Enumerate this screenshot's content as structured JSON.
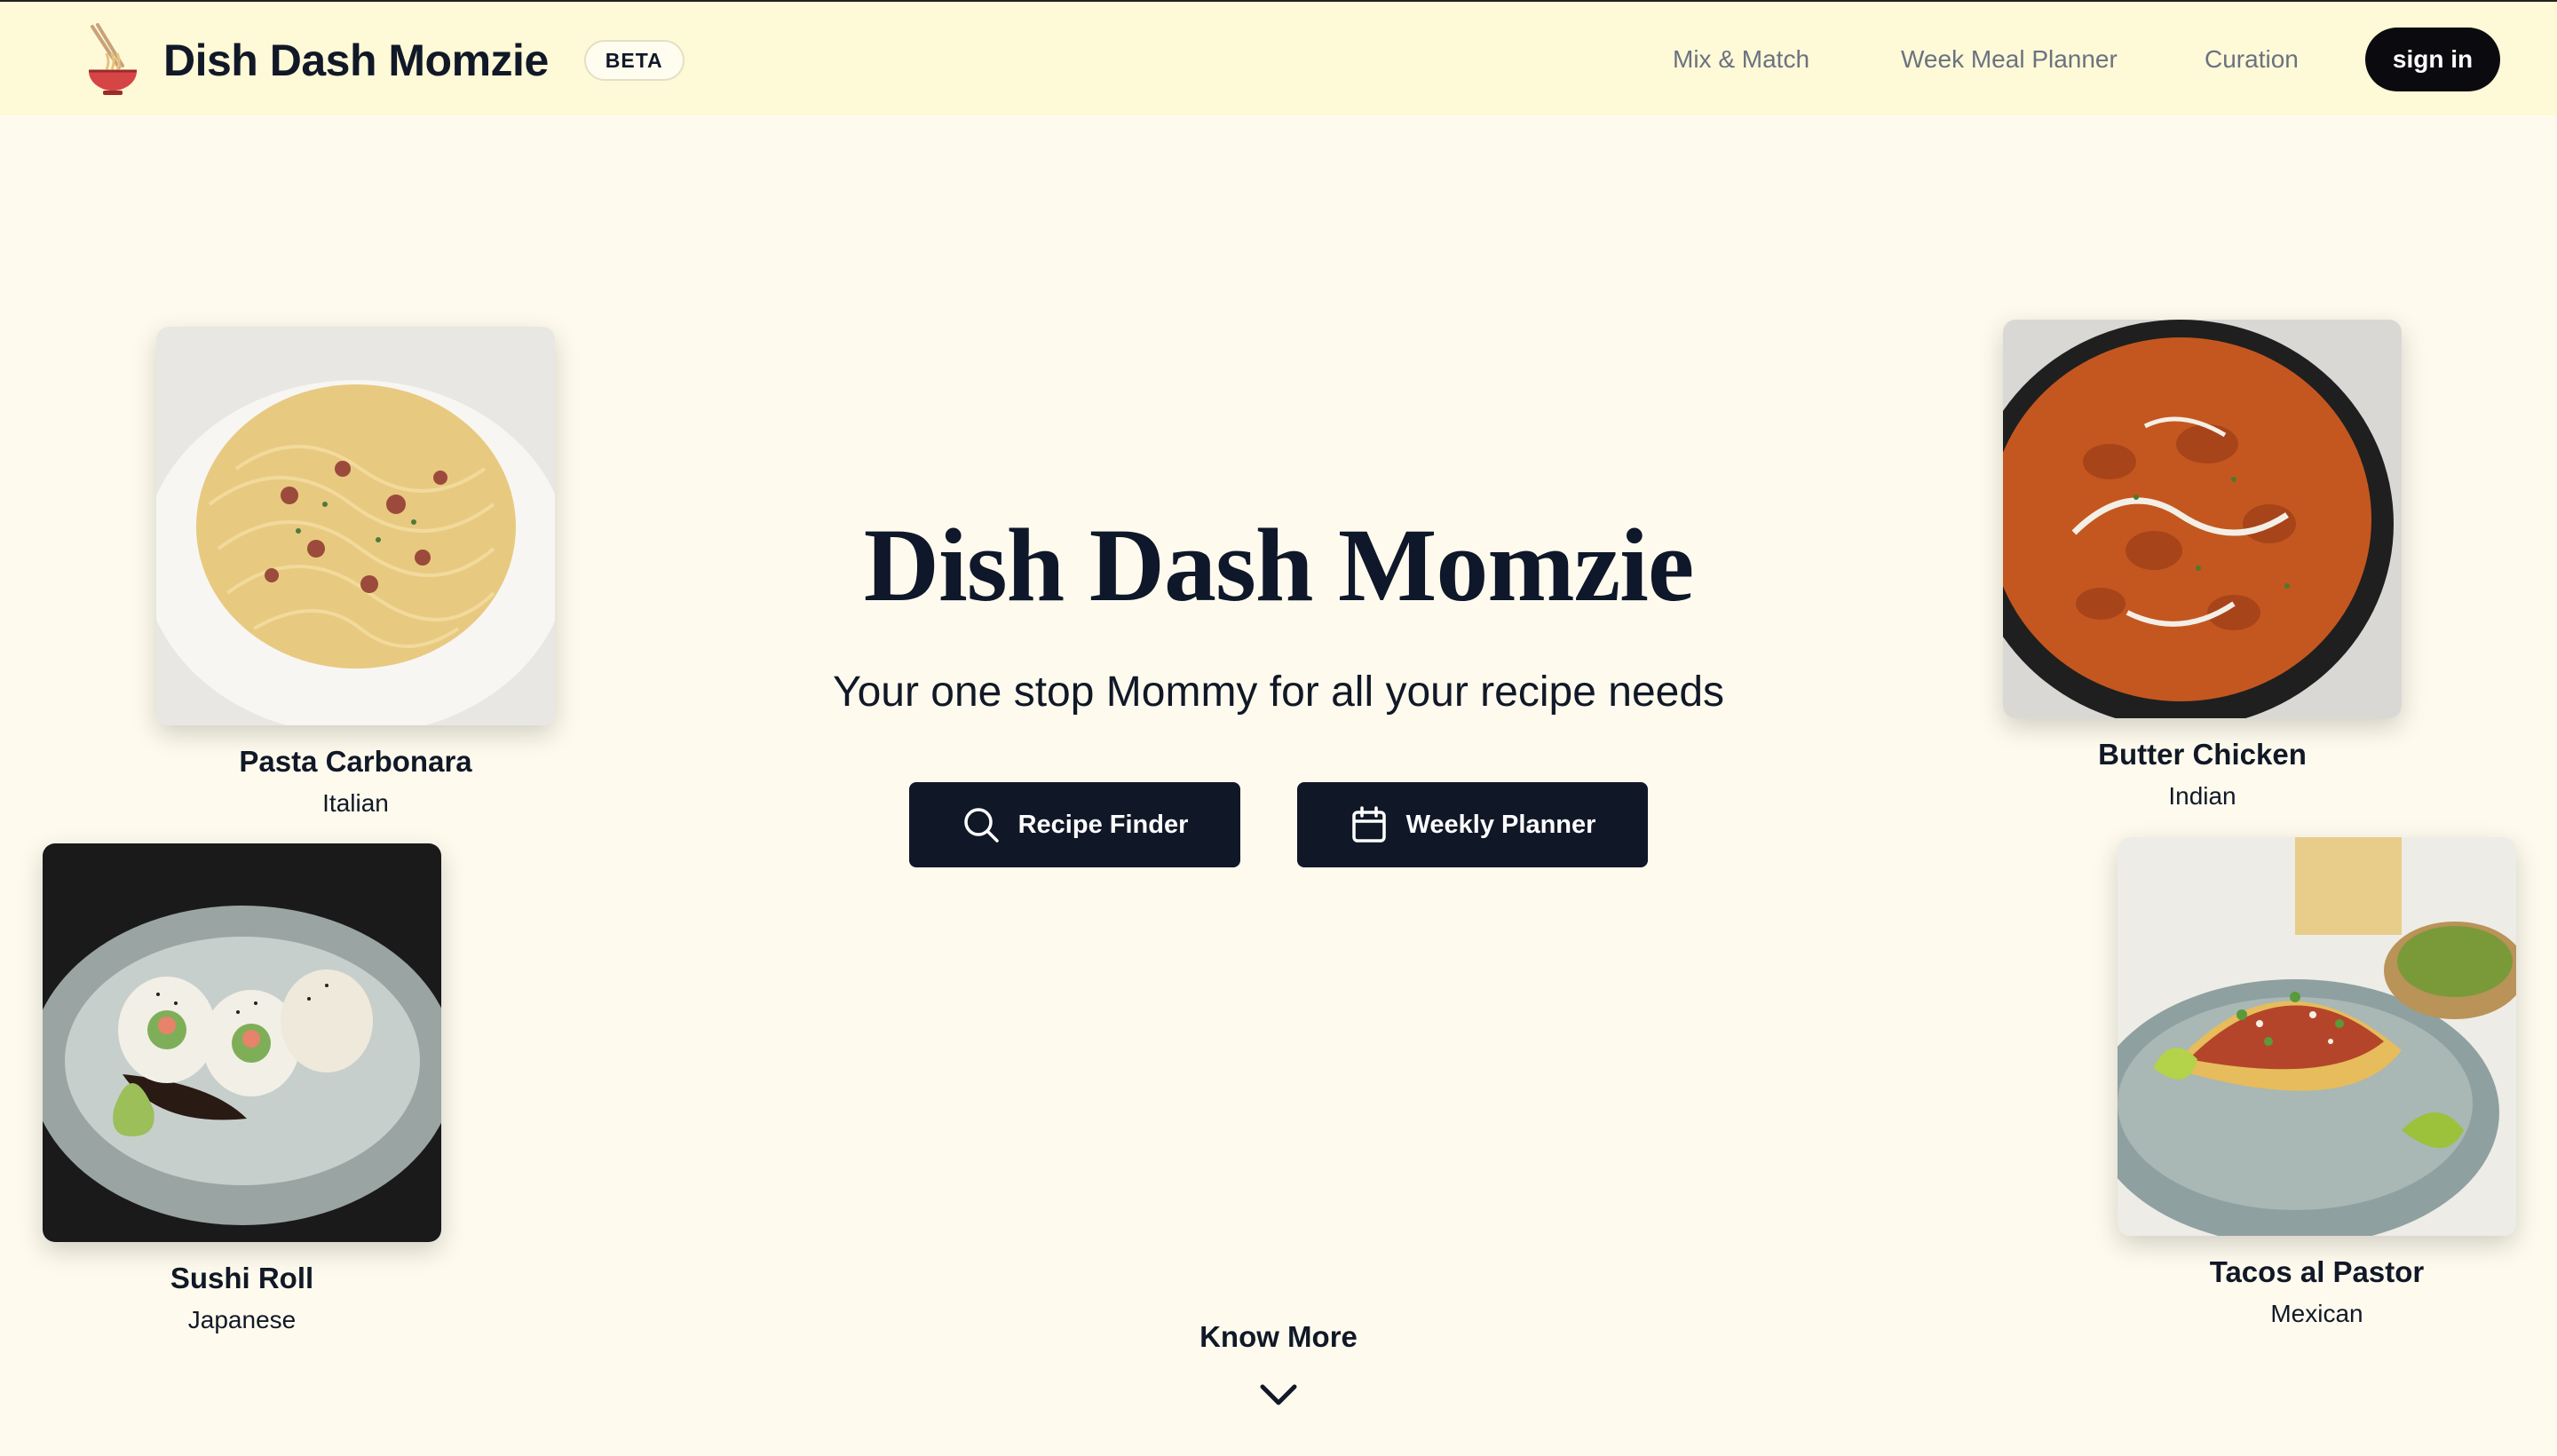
{
  "header": {
    "brand": "Dish Dash Momzie",
    "badge": "BETA",
    "nav": [
      "Mix & Match",
      "Week Meal Planner",
      "Curation"
    ],
    "signin_label": "sign in"
  },
  "hero": {
    "title": "Dish Dash Momzie",
    "subtitle": "Your one stop Mommy for all your recipe needs",
    "buttons": [
      {
        "label": "Recipe Finder",
        "icon": "search-icon"
      },
      {
        "label": "Weekly Planner",
        "icon": "calendar-icon"
      }
    ]
  },
  "dishes": [
    {
      "name": "Pasta Carbonara",
      "cuisine": "Italian"
    },
    {
      "name": "Sushi Roll",
      "cuisine": "Japanese"
    },
    {
      "name": "Butter Chicken",
      "cuisine": "Indian"
    },
    {
      "name": "Tacos al Pastor",
      "cuisine": "Mexican"
    }
  ],
  "footer": {
    "know_more": "Know More",
    "icon": "chevron-down-icon"
  },
  "colors": {
    "background": "#fefbee",
    "header_bg": "#fef9d7",
    "button_bg": "#101828",
    "text": "#111827",
    "nav_text": "#6b7280"
  }
}
